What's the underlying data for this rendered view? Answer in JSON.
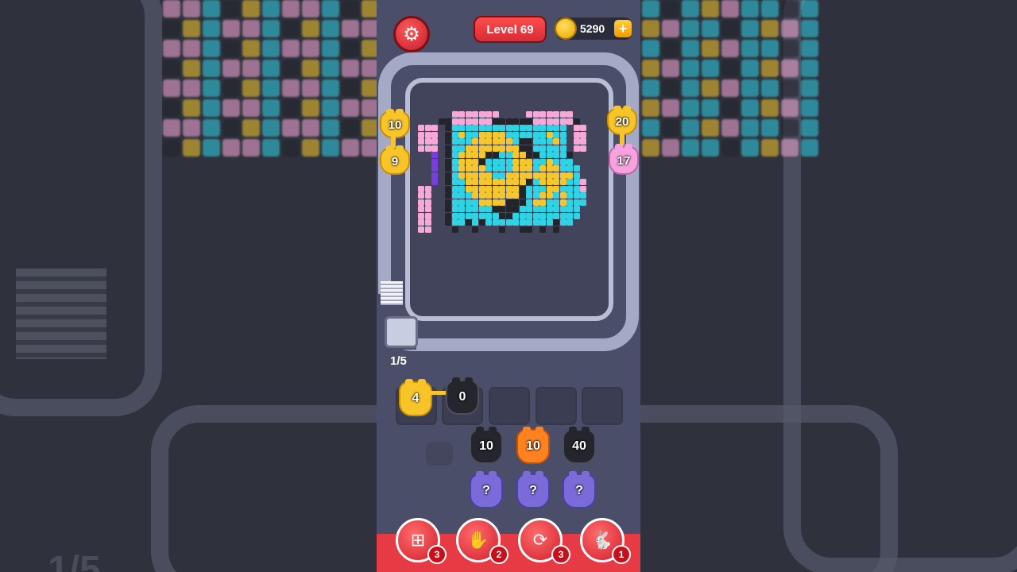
{
  "header": {
    "level_label": "Level 69",
    "coins": "5290",
    "plus_icon": "+"
  },
  "board": {
    "queue_counter": "1/5",
    "side_pigs": {
      "left_top": "10",
      "left_bottom": "9",
      "right_top": "20",
      "right_bottom": "17"
    }
  },
  "active_slots": [
    {
      "value": "4",
      "color": "yellow"
    },
    {
      "value": "0",
      "color": "black"
    }
  ],
  "waiting_pigs": [
    {
      "value": "10",
      "color": "black"
    },
    {
      "value": "10",
      "color": "orange"
    },
    {
      "value": "40",
      "color": "black"
    }
  ],
  "mystery_pigs": [
    "?",
    "?",
    "?"
  ],
  "powerups": [
    {
      "name": "add-slot",
      "count": "3"
    },
    {
      "name": "hand",
      "count": "2"
    },
    {
      "name": "shuffle",
      "count": "3"
    },
    {
      "name": "rabbit",
      "count": "1"
    }
  ],
  "colors": {
    "pink": "#f7a8d8",
    "cyan": "#2ed3e6",
    "yellow": "#f6c72c",
    "black": "#24252b",
    "purple": "#7b3ce0",
    "accent_red": "#e63b45"
  },
  "background_text": "1/5"
}
